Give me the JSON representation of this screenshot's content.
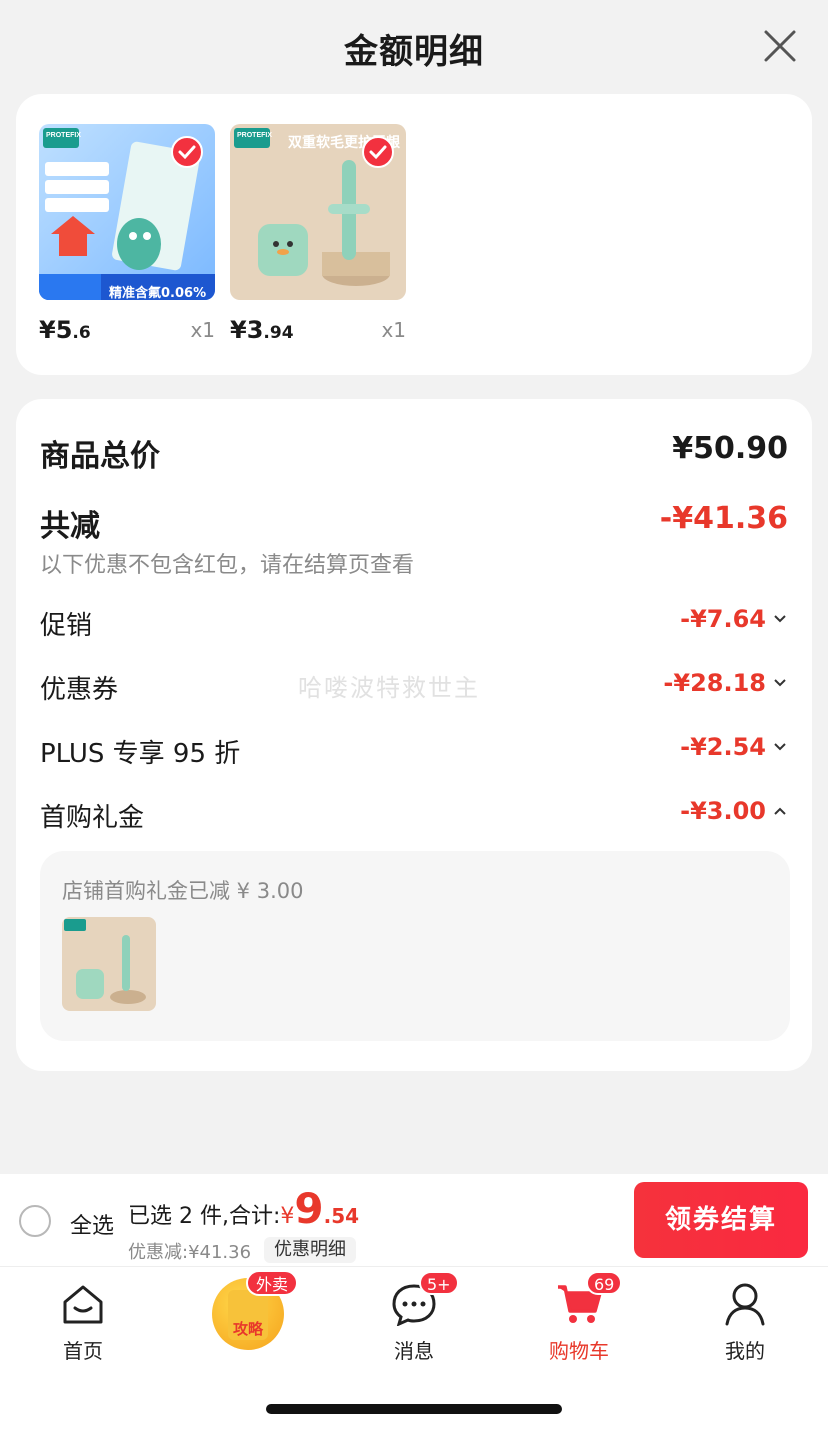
{
  "header": {
    "title": "金额明细"
  },
  "products": [
    {
      "price_int": "¥5",
      "price_dec": ".6",
      "qty": "x1",
      "image_caption": "精准含氟0.06%",
      "brand": "PROTEFIX"
    },
    {
      "price_int": "¥3",
      "price_dec": ".94",
      "qty": "x1",
      "image_caption": "双重软毛更护牙龈",
      "brand": "PROTEFIX"
    }
  ],
  "details": {
    "total_label": "商品总价",
    "total_value": "¥50.90",
    "reduce_label": "共减",
    "reduce_value": "-¥41.36",
    "reduce_note": "以下优惠不包含红包，请在结算页查看",
    "items": [
      {
        "label": "促销",
        "value": "-¥7.64"
      },
      {
        "label": "优惠券",
        "value": "-¥28.18"
      },
      {
        "label": "PLUS 专享 95 折",
        "value": "-¥2.54"
      },
      {
        "label": "首购礼金",
        "value": "-¥3.00"
      }
    ],
    "gift_text": "店铺首购礼金已减 ¥ 3.00",
    "watermark": "哈喽波特救世主"
  },
  "bottom_bar": {
    "select_all": "全选",
    "selected_text": "已选 2 件,合计:",
    "total_symbol": "¥",
    "total_int": "9",
    "total_dec": ".54",
    "discount_text": "优惠减:¥41.36",
    "detail_chip": "优惠明细",
    "checkout": "领券结算"
  },
  "tabbar": {
    "home": "首页",
    "promo_badge": "外卖",
    "promo_text": "攻略",
    "messages": "消息",
    "messages_badge": "5+",
    "cart": "购物车",
    "cart_badge": "69",
    "mine": "我的"
  },
  "colors": {
    "accent": "#e8382b",
    "checkout": "#f5323c"
  }
}
